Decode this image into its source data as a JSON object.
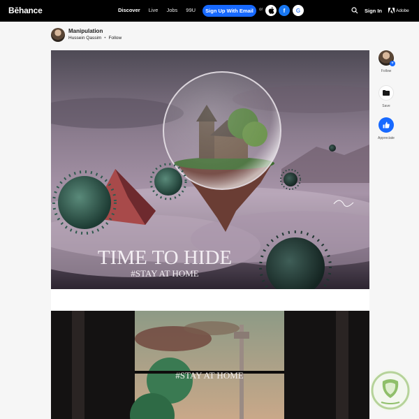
{
  "nav": {
    "logo": "Bēhance",
    "links": [
      "Discover",
      "Live",
      "Jobs",
      "99U"
    ],
    "signup": "Sign Up With Email",
    "or": "or",
    "apple": "",
    "facebook": "f",
    "google": "G",
    "signin": "Sign In",
    "adobe": "Adobe"
  },
  "project": {
    "title": "Manipulation",
    "owner": "Hussein Qassim",
    "separator": "•",
    "follow": "Follow"
  },
  "image1": {
    "headline": "TIME TO HIDE",
    "subline": "#STAY AT HOME"
  },
  "image2": {
    "banner": "#STAY AT HOME"
  },
  "rail": {
    "follow": "Follow",
    "save": "Save",
    "appreciate": "Appreciate"
  },
  "colors": {
    "accent": "#1769ff",
    "nav_bg": "#000000"
  }
}
